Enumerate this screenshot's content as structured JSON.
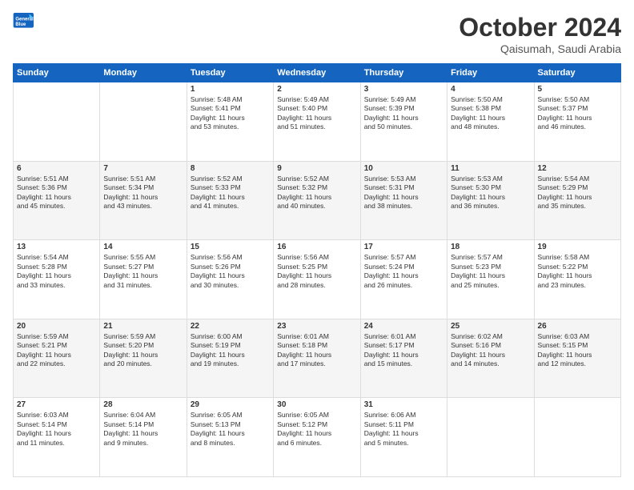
{
  "header": {
    "logo_general": "General",
    "logo_blue": "Blue",
    "month": "October 2024",
    "location": "Qaisumah, Saudi Arabia"
  },
  "weekdays": [
    "Sunday",
    "Monday",
    "Tuesday",
    "Wednesday",
    "Thursday",
    "Friday",
    "Saturday"
  ],
  "weeks": [
    [
      {
        "day": "",
        "info": ""
      },
      {
        "day": "",
        "info": ""
      },
      {
        "day": "1",
        "info": "Sunrise: 5:48 AM\nSunset: 5:41 PM\nDaylight: 11 hours\nand 53 minutes."
      },
      {
        "day": "2",
        "info": "Sunrise: 5:49 AM\nSunset: 5:40 PM\nDaylight: 11 hours\nand 51 minutes."
      },
      {
        "day": "3",
        "info": "Sunrise: 5:49 AM\nSunset: 5:39 PM\nDaylight: 11 hours\nand 50 minutes."
      },
      {
        "day": "4",
        "info": "Sunrise: 5:50 AM\nSunset: 5:38 PM\nDaylight: 11 hours\nand 48 minutes."
      },
      {
        "day": "5",
        "info": "Sunrise: 5:50 AM\nSunset: 5:37 PM\nDaylight: 11 hours\nand 46 minutes."
      }
    ],
    [
      {
        "day": "6",
        "info": "Sunrise: 5:51 AM\nSunset: 5:36 PM\nDaylight: 11 hours\nand 45 minutes."
      },
      {
        "day": "7",
        "info": "Sunrise: 5:51 AM\nSunset: 5:34 PM\nDaylight: 11 hours\nand 43 minutes."
      },
      {
        "day": "8",
        "info": "Sunrise: 5:52 AM\nSunset: 5:33 PM\nDaylight: 11 hours\nand 41 minutes."
      },
      {
        "day": "9",
        "info": "Sunrise: 5:52 AM\nSunset: 5:32 PM\nDaylight: 11 hours\nand 40 minutes."
      },
      {
        "day": "10",
        "info": "Sunrise: 5:53 AM\nSunset: 5:31 PM\nDaylight: 11 hours\nand 38 minutes."
      },
      {
        "day": "11",
        "info": "Sunrise: 5:53 AM\nSunset: 5:30 PM\nDaylight: 11 hours\nand 36 minutes."
      },
      {
        "day": "12",
        "info": "Sunrise: 5:54 AM\nSunset: 5:29 PM\nDaylight: 11 hours\nand 35 minutes."
      }
    ],
    [
      {
        "day": "13",
        "info": "Sunrise: 5:54 AM\nSunset: 5:28 PM\nDaylight: 11 hours\nand 33 minutes."
      },
      {
        "day": "14",
        "info": "Sunrise: 5:55 AM\nSunset: 5:27 PM\nDaylight: 11 hours\nand 31 minutes."
      },
      {
        "day": "15",
        "info": "Sunrise: 5:56 AM\nSunset: 5:26 PM\nDaylight: 11 hours\nand 30 minutes."
      },
      {
        "day": "16",
        "info": "Sunrise: 5:56 AM\nSunset: 5:25 PM\nDaylight: 11 hours\nand 28 minutes."
      },
      {
        "day": "17",
        "info": "Sunrise: 5:57 AM\nSunset: 5:24 PM\nDaylight: 11 hours\nand 26 minutes."
      },
      {
        "day": "18",
        "info": "Sunrise: 5:57 AM\nSunset: 5:23 PM\nDaylight: 11 hours\nand 25 minutes."
      },
      {
        "day": "19",
        "info": "Sunrise: 5:58 AM\nSunset: 5:22 PM\nDaylight: 11 hours\nand 23 minutes."
      }
    ],
    [
      {
        "day": "20",
        "info": "Sunrise: 5:59 AM\nSunset: 5:21 PM\nDaylight: 11 hours\nand 22 minutes."
      },
      {
        "day": "21",
        "info": "Sunrise: 5:59 AM\nSunset: 5:20 PM\nDaylight: 11 hours\nand 20 minutes."
      },
      {
        "day": "22",
        "info": "Sunrise: 6:00 AM\nSunset: 5:19 PM\nDaylight: 11 hours\nand 19 minutes."
      },
      {
        "day": "23",
        "info": "Sunrise: 6:01 AM\nSunset: 5:18 PM\nDaylight: 11 hours\nand 17 minutes."
      },
      {
        "day": "24",
        "info": "Sunrise: 6:01 AM\nSunset: 5:17 PM\nDaylight: 11 hours\nand 15 minutes."
      },
      {
        "day": "25",
        "info": "Sunrise: 6:02 AM\nSunset: 5:16 PM\nDaylight: 11 hours\nand 14 minutes."
      },
      {
        "day": "26",
        "info": "Sunrise: 6:03 AM\nSunset: 5:15 PM\nDaylight: 11 hours\nand 12 minutes."
      }
    ],
    [
      {
        "day": "27",
        "info": "Sunrise: 6:03 AM\nSunset: 5:14 PM\nDaylight: 11 hours\nand 11 minutes."
      },
      {
        "day": "28",
        "info": "Sunrise: 6:04 AM\nSunset: 5:14 PM\nDaylight: 11 hours\nand 9 minutes."
      },
      {
        "day": "29",
        "info": "Sunrise: 6:05 AM\nSunset: 5:13 PM\nDaylight: 11 hours\nand 8 minutes."
      },
      {
        "day": "30",
        "info": "Sunrise: 6:05 AM\nSunset: 5:12 PM\nDaylight: 11 hours\nand 6 minutes."
      },
      {
        "day": "31",
        "info": "Sunrise: 6:06 AM\nSunset: 5:11 PM\nDaylight: 11 hours\nand 5 minutes."
      },
      {
        "day": "",
        "info": ""
      },
      {
        "day": "",
        "info": ""
      }
    ]
  ]
}
